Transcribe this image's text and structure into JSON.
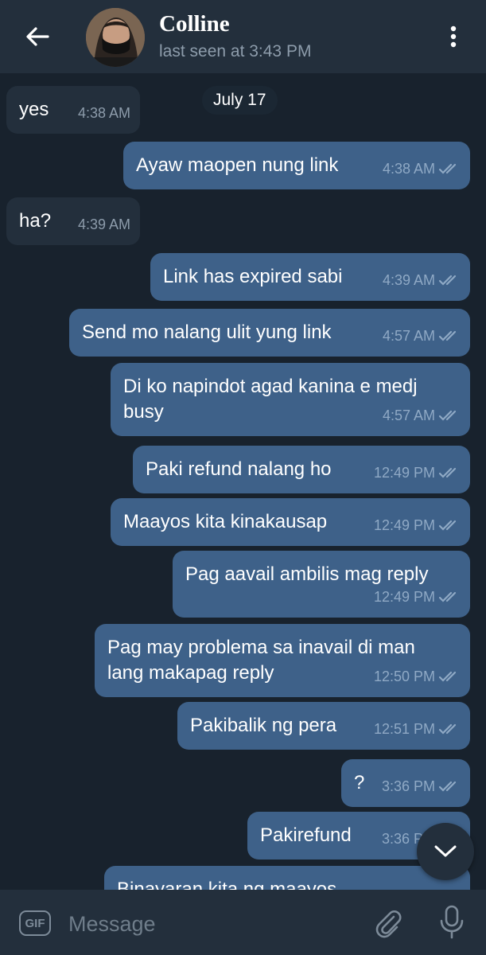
{
  "header": {
    "contact_name": "Colline",
    "status": "last seen at 3:43 PM"
  },
  "chat": {
    "date_label": "July 17",
    "messages": [
      {
        "dir": "in",
        "text": "yes",
        "time": "4:38 AM"
      },
      {
        "dir": "out",
        "text": "Ayaw maopen nung link",
        "time": "4:38 AM"
      },
      {
        "dir": "in",
        "text": "ha?",
        "time": "4:39 AM"
      },
      {
        "dir": "out",
        "text": "Link has expired sabi",
        "time": "4:39 AM"
      },
      {
        "dir": "out",
        "text": "Send mo nalang ulit yung link",
        "time": "4:57 AM"
      },
      {
        "dir": "out",
        "text": "Di ko napindot agad kanina e medj\nbusy",
        "time": "4:57 AM"
      },
      {
        "dir": "out",
        "text": "Paki refund nalang ho",
        "time": "12:49 PM"
      },
      {
        "dir": "out",
        "text": "Maayos kita kinakausap",
        "time": "12:49 PM"
      },
      {
        "dir": "out",
        "text": "Pag aavail ambilis mag reply",
        "time": "12:49 PM"
      },
      {
        "dir": "out",
        "text": "Pag may problema sa inavail di man\nlang makapag reply",
        "time": "12:50 PM"
      },
      {
        "dir": "out",
        "text": "Pakibalik ng pera",
        "time": "12:51 PM"
      },
      {
        "dir": "out",
        "text": "?",
        "time": "3:36 PM"
      },
      {
        "dir": "out",
        "text": "Pakirefund",
        "time": "3:36 PM"
      },
      {
        "dir": "out",
        "text": "Binayaran kita ng maayos",
        "time": ""
      }
    ]
  },
  "input": {
    "gif_label": "GIF",
    "placeholder": "Message"
  },
  "icons": {
    "back": "arrow-left-icon",
    "menu": "more-vertical-icon",
    "scroll_down": "chevron-down-icon",
    "attach": "paperclip-icon",
    "mic": "microphone-icon",
    "read_status": "double-check-icon"
  },
  "colors": {
    "background": "#18222d",
    "header": "#232f3c",
    "incoming_bubble": "#232f3c",
    "outgoing_bubble": "#3e6189",
    "tick": "#8fa9c5"
  }
}
